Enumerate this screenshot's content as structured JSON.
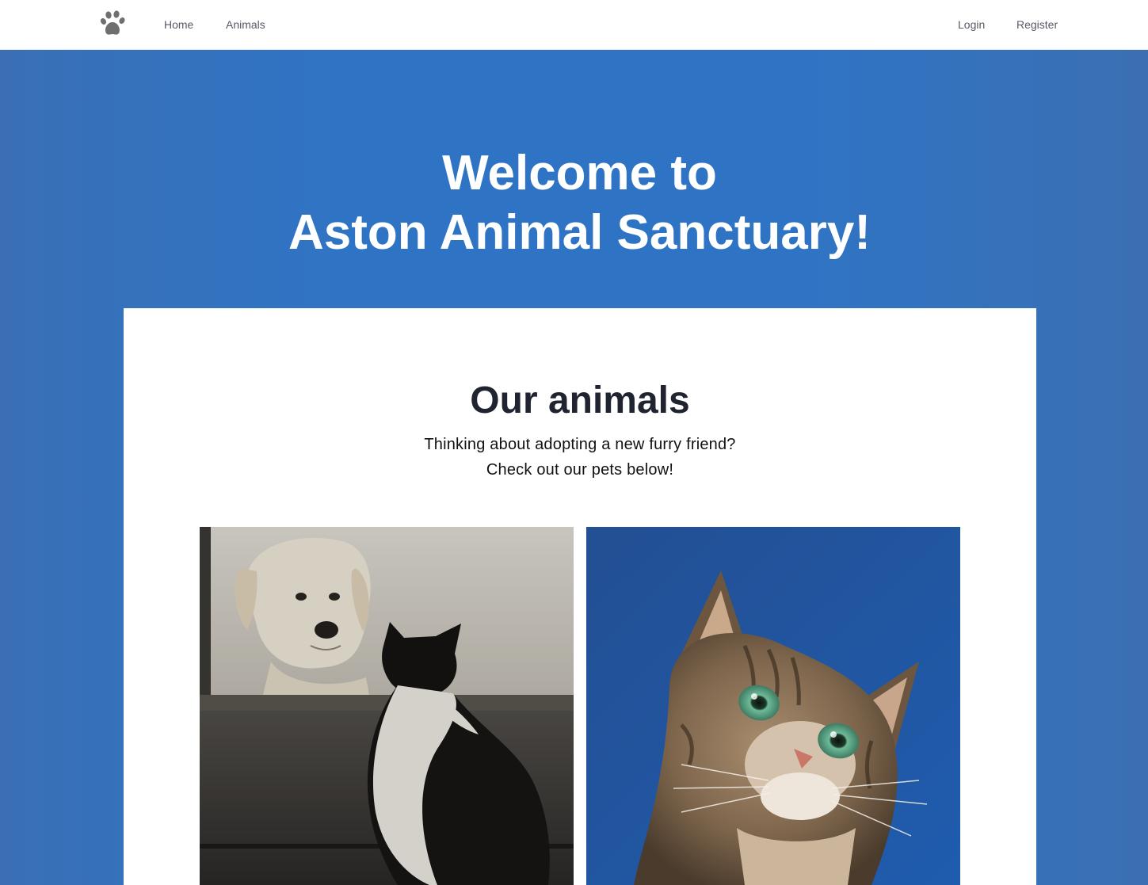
{
  "nav": {
    "logo_icon": "paw-icon",
    "links": {
      "home": "Home",
      "animals": "Animals",
      "login": "Login",
      "register": "Register"
    }
  },
  "hero": {
    "title_line1": "Welcome to",
    "title_line2": "Aston Animal Sanctuary!"
  },
  "section": {
    "title": "Our animals",
    "subtitle_line1": "Thinking about adopting a new furry friend?",
    "subtitle_line2": "Check out our pets below!"
  },
  "colors": {
    "hero_blue": "#2f74c4",
    "nav_text": "#555a63",
    "heading_dark": "#1f2430"
  }
}
